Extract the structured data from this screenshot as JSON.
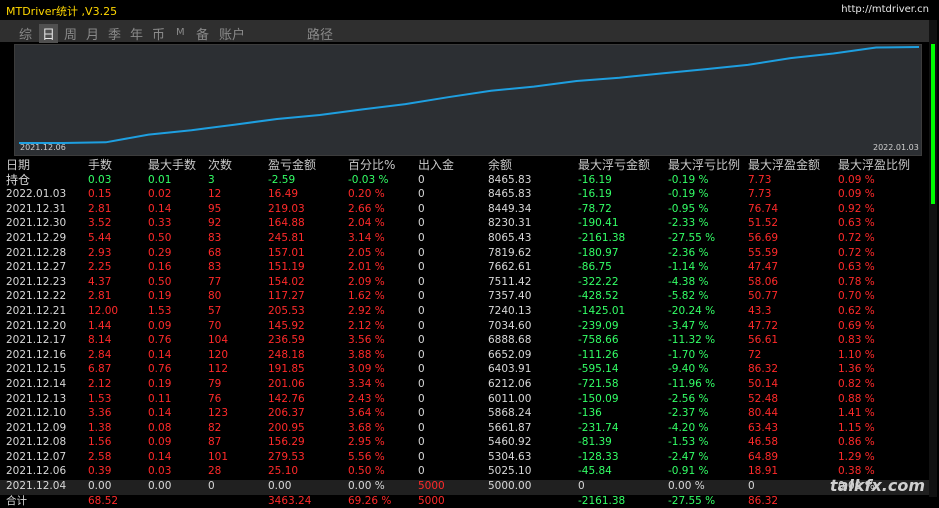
{
  "window": {
    "title": "MTDriver统计 ,V3.25",
    "url": "http://mtdriver.cn"
  },
  "tabs": [
    {
      "label": "综",
      "active": false
    },
    {
      "label": "日",
      "active": true
    },
    {
      "label": "周",
      "active": false
    },
    {
      "label": "月",
      "active": false
    },
    {
      "label": "季",
      "active": false
    },
    {
      "label": "年",
      "active": false
    },
    {
      "label": "币",
      "active": false
    },
    {
      "label": "M",
      "active": false
    },
    {
      "label": "备",
      "active": false
    },
    {
      "label": "账户",
      "active": false
    },
    {
      "label": "路径",
      "active": false
    }
  ],
  "chart_data": {
    "type": "line",
    "x_start_label": "2021.12.06",
    "x_end_label": "2022.01.03",
    "line_color": "#1e9fe0",
    "x": [
      "2021.12.04",
      "2021.12.06",
      "2021.12.07",
      "2021.12.08",
      "2021.12.09",
      "2021.12.10",
      "2021.12.13",
      "2021.12.14",
      "2021.12.15",
      "2021.12.16",
      "2021.12.17",
      "2021.12.20",
      "2021.12.21",
      "2021.12.22",
      "2021.12.23",
      "2021.12.27",
      "2021.12.28",
      "2021.12.29",
      "2021.12.30",
      "2021.12.31",
      "2022.01.03"
    ],
    "y": [
      5000.0,
      5025.1,
      5304.63,
      5460.92,
      5661.87,
      5868.24,
      6011.0,
      6212.06,
      6403.91,
      6652.09,
      6888.68,
      7034.6,
      7240.13,
      7357.4,
      7511.42,
      7662.61,
      7819.62,
      8065.43,
      8230.31,
      8449.34,
      8465.83
    ]
  },
  "table": {
    "headers": [
      "日期",
      "手数",
      "最大手数",
      "次数",
      "盈亏金额",
      "百分比%",
      "出入金",
      "余额",
      "最大浮亏金额",
      "最大浮亏比例",
      "最大浮盈金额",
      "最大浮盈比例"
    ],
    "hold": [
      "持仓",
      "0.03",
      "0.01",
      "3",
      "-2.59",
      "-0.03 %",
      "0",
      "8465.83",
      "-16.19",
      "-0.19 %",
      "7.73",
      "0.09 %"
    ],
    "rows": [
      [
        "2022.01.03",
        "0.15",
        "0.02",
        "12",
        "16.49",
        "0.20 %",
        "0",
        "8465.83",
        "-16.19",
        "-0.19 %",
        "7.73",
        "0.09 %"
      ],
      [
        "2021.12.31",
        "2.81",
        "0.14",
        "95",
        "219.03",
        "2.66 %",
        "0",
        "8449.34",
        "-78.72",
        "-0.95 %",
        "76.74",
        "0.92 %"
      ],
      [
        "2021.12.30",
        "3.52",
        "0.33",
        "92",
        "164.88",
        "2.04 %",
        "0",
        "8230.31",
        "-190.41",
        "-2.33 %",
        "51.52",
        "0.63 %"
      ],
      [
        "2021.12.29",
        "5.44",
        "0.50",
        "83",
        "245.81",
        "3.14 %",
        "0",
        "8065.43",
        "-2161.38",
        "-27.55 %",
        "56.69",
        "0.72 %"
      ],
      [
        "2021.12.28",
        "2.93",
        "0.29",
        "68",
        "157.01",
        "2.05 %",
        "0",
        "7819.62",
        "-180.97",
        "-2.36 %",
        "55.59",
        "0.72 %"
      ],
      [
        "2021.12.27",
        "2.25",
        "0.16",
        "83",
        "151.19",
        "2.01 %",
        "0",
        "7662.61",
        "-86.75",
        "-1.14 %",
        "47.47",
        "0.63 %"
      ],
      [
        "2021.12.23",
        "4.37",
        "0.50",
        "77",
        "154.02",
        "2.09 %",
        "0",
        "7511.42",
        "-322.22",
        "-4.38 %",
        "58.06",
        "0.78 %"
      ],
      [
        "2021.12.22",
        "2.81",
        "0.19",
        "80",
        "117.27",
        "1.62 %",
        "0",
        "7357.40",
        "-428.52",
        "-5.82 %",
        "50.77",
        "0.70 %"
      ],
      [
        "2021.12.21",
        "12.00",
        "1.53",
        "57",
        "205.53",
        "2.92 %",
        "0",
        "7240.13",
        "-1425.01",
        "-20.24 %",
        "43.3",
        "0.62 %"
      ],
      [
        "2021.12.20",
        "1.44",
        "0.09",
        "70",
        "145.92",
        "2.12 %",
        "0",
        "7034.60",
        "-239.09",
        "-3.47 %",
        "47.72",
        "0.69 %"
      ],
      [
        "2021.12.17",
        "8.14",
        "0.76",
        "104",
        "236.59",
        "3.56 %",
        "0",
        "6888.68",
        "-758.66",
        "-11.32 %",
        "56.61",
        "0.83 %"
      ],
      [
        "2021.12.16",
        "2.84",
        "0.14",
        "120",
        "248.18",
        "3.88 %",
        "0",
        "6652.09",
        "-111.26",
        "-1.70 %",
        "72",
        "1.10 %"
      ],
      [
        "2021.12.15",
        "6.87",
        "0.76",
        "112",
        "191.85",
        "3.09 %",
        "0",
        "6403.91",
        "-595.14",
        "-9.40 %",
        "86.32",
        "1.36 %"
      ],
      [
        "2021.12.14",
        "2.12",
        "0.19",
        "79",
        "201.06",
        "3.34 %",
        "0",
        "6212.06",
        "-721.58",
        "-11.96 %",
        "50.14",
        "0.82 %"
      ],
      [
        "2021.12.13",
        "1.53",
        "0.11",
        "76",
        "142.76",
        "2.43 %",
        "0",
        "6011.00",
        "-150.09",
        "-2.56 %",
        "52.48",
        "0.88 %"
      ],
      [
        "2021.12.10",
        "3.36",
        "0.14",
        "123",
        "206.37",
        "3.64 %",
        "0",
        "5868.24",
        "-136",
        "-2.37 %",
        "80.44",
        "1.41 %"
      ],
      [
        "2021.12.09",
        "1.38",
        "0.08",
        "82",
        "200.95",
        "3.68 %",
        "0",
        "5661.87",
        "-231.74",
        "-4.20 %",
        "63.43",
        "1.15 %"
      ],
      [
        "2021.12.08",
        "1.56",
        "0.09",
        "87",
        "156.29",
        "2.95 %",
        "0",
        "5460.92",
        "-81.39",
        "-1.53 %",
        "46.58",
        "0.86 %"
      ],
      [
        "2021.12.07",
        "2.58",
        "0.14",
        "101",
        "279.53",
        "5.56 %",
        "0",
        "5304.63",
        "-128.33",
        "-2.47 %",
        "64.89",
        "1.29 %"
      ],
      [
        "2021.12.06",
        "0.39",
        "0.03",
        "28",
        "25.10",
        "0.50 %",
        "0",
        "5025.10",
        "-45.84",
        "-0.91 %",
        "18.91",
        "0.38 %"
      ],
      [
        "2021.12.04",
        "0.00",
        "0.00",
        "0",
        "0.00",
        "0.00 %",
        "5000",
        "5000.00",
        "0",
        "0.00 %",
        "0",
        "0.00 %"
      ]
    ],
    "total": [
      "合计",
      "68.52",
      "",
      "",
      "3463.24",
      "69.26 %",
      "5000",
      "",
      "-2161.38",
      "-27.55 %",
      "86.32",
      ""
    ]
  },
  "watermark": "talkfx.com"
}
